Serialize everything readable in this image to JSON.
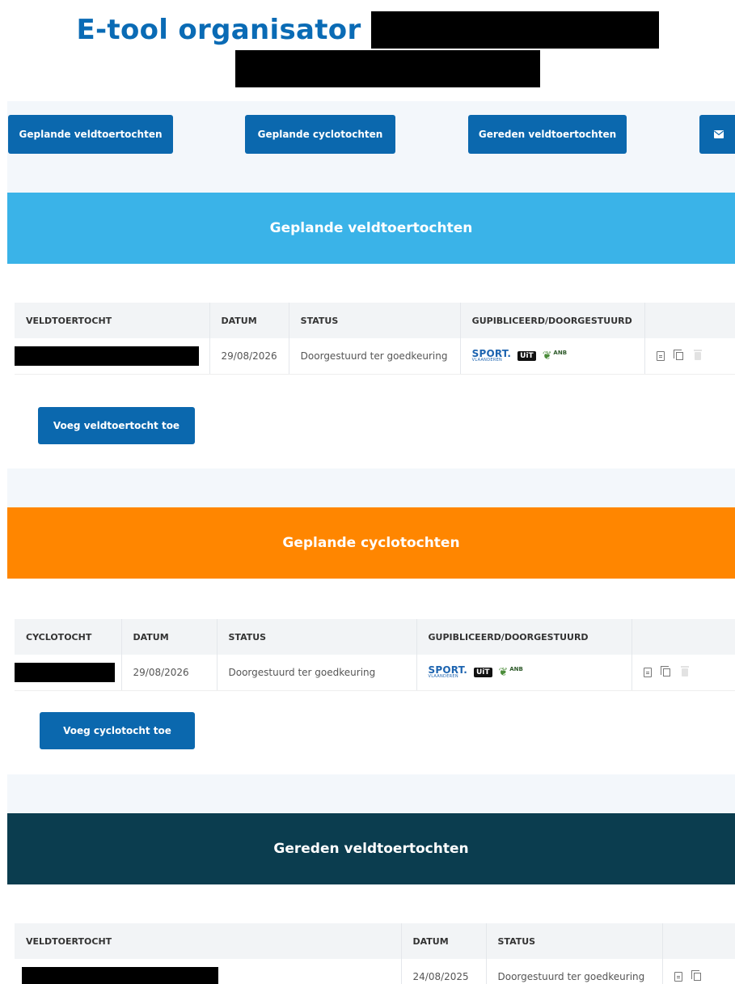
{
  "header": {
    "title": "E-tool organisator"
  },
  "nav": {
    "btn1": "Geplande veldtoertochten",
    "btn2": "Geplande cyclotochten",
    "btn3": "Gereden veldtoertochten",
    "mail_icon": "envelope-icon"
  },
  "section1": {
    "title": "Geplande veldtoertochten",
    "headers": [
      "VELDTOERTOCHT",
      "DATUM",
      "STATUS",
      "GUPIBLICEERD/DOORGESTUURD",
      ""
    ],
    "row": {
      "date": "29/08/2026",
      "status": "Doorgestuurd ter goedkeuring"
    },
    "add_label": "Voeg veldtoertocht toe"
  },
  "section2": {
    "title": "Geplande cyclotochten",
    "headers": [
      "CYCLOTOCHT",
      "DATUM",
      "STATUS",
      "GUPIBLICEERD/DOORGESTUURD",
      ""
    ],
    "row": {
      "date": "29/08/2026",
      "status": "Doorgestuurd ter goedkeuring"
    },
    "add_label": "Voeg cyclotocht toe"
  },
  "section3": {
    "title": "Gereden veldtoertochten",
    "headers": [
      "VELDTOERTOCHT",
      "DATUM",
      "STATUS",
      ""
    ],
    "row": {
      "date": "24/08/2025",
      "status": "Doorgestuurd ter goedkeuring"
    }
  },
  "logos": {
    "sport": "SPORT.",
    "sport_sub": "VLAANDEREN",
    "uit": "UiT",
    "anb": "ANB"
  },
  "colors": {
    "primary": "#0b68ae",
    "title": "#0a6bb5",
    "section1": "#3ab3e8",
    "section2": "#ff8600",
    "section3": "#0b3d4f"
  }
}
